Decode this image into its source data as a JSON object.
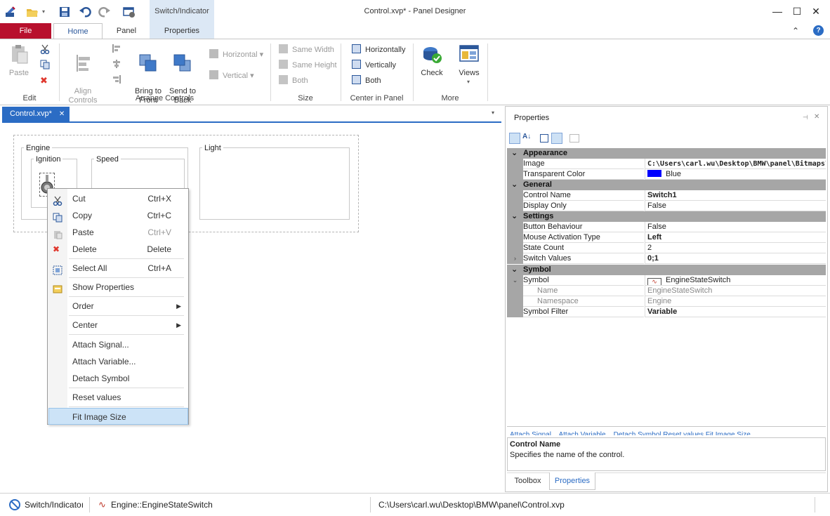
{
  "titlebar": {
    "context_tab_group": "Switch/Indicator",
    "title": "Control.xvp* - Panel Designer",
    "minimize": "—",
    "maximize": "☐",
    "close": "✕"
  },
  "ribbon_tabs": {
    "file": "File",
    "home": "Home",
    "panel": "Panel",
    "properties": "Properties"
  },
  "ribbon": {
    "edit": {
      "paste": "Paste",
      "group": "Edit"
    },
    "arrange": {
      "align": "Align\nControls",
      "bring_front": "Bring to\nFront",
      "send_back": "Send to\nBack",
      "horizontal": "Horizontal",
      "vertical": "Vertical",
      "group": "Arrange Controls"
    },
    "size": {
      "same_width": "Same Width",
      "same_height": "Same Height",
      "both": "Both",
      "group": "Size"
    },
    "center": {
      "horizontally": "Horizontally",
      "vertically": "Vertically",
      "both": "Both",
      "group": "Center in Panel"
    },
    "more": {
      "check": "Check",
      "views": "Views",
      "group": "More"
    }
  },
  "document": {
    "tab": "Control.xvp*",
    "groups": {
      "engine": "Engine",
      "ignition": "Ignition",
      "speed": "Speed",
      "light": "Light"
    }
  },
  "context_menu": {
    "items": [
      {
        "label": "Cut",
        "shortcut": "Ctrl+X"
      },
      {
        "label": "Copy",
        "shortcut": "Ctrl+C"
      },
      {
        "label": "Paste",
        "shortcut": "Ctrl+V"
      },
      {
        "label": "Delete",
        "shortcut": "Delete"
      },
      {
        "label": "Select All",
        "shortcut": "Ctrl+A"
      },
      {
        "label": "Show Properties",
        "shortcut": ""
      },
      {
        "label": "Order",
        "shortcut": ""
      },
      {
        "label": "Center",
        "shortcut": ""
      },
      {
        "label": "Attach Signal...",
        "shortcut": ""
      },
      {
        "label": "Attach Variable...",
        "shortcut": ""
      },
      {
        "label": "Detach Symbol",
        "shortcut": ""
      },
      {
        "label": "Reset values",
        "shortcut": ""
      },
      {
        "label": "Fit Image Size",
        "shortcut": ""
      }
    ]
  },
  "properties": {
    "title": "Properties",
    "categories": {
      "appearance": "Appearance",
      "general": "General",
      "settings": "Settings",
      "symbol": "Symbol"
    },
    "rows": {
      "image": {
        "name": "Image",
        "value": "C:\\Users\\carl.wu\\Desktop\\BMW\\panel\\Bitmaps\\"
      },
      "transparent": {
        "name": "Transparent Color",
        "value": "Blue",
        "color": "#0000ff"
      },
      "control_name": {
        "name": "Control Name",
        "value": "Switch1"
      },
      "display_only": {
        "name": "Display Only",
        "value": "False"
      },
      "button_behaviour": {
        "name": "Button Behaviour",
        "value": "False"
      },
      "mouse_activation": {
        "name": "Mouse Activation Type",
        "value": "Left"
      },
      "state_count": {
        "name": "State Count",
        "value": "2"
      },
      "switch_values": {
        "name": "Switch Values",
        "value": "0;1"
      },
      "symbol": {
        "name": "Symbol",
        "value": "EngineStateSwitch"
      },
      "sym_name": {
        "name": "Name",
        "value": "EngineStateSwitch"
      },
      "sym_namespace": {
        "name": "Namespace",
        "value": "Engine"
      },
      "symbol_filter": {
        "name": "Symbol Filter",
        "value": "Variable"
      }
    },
    "commands": "Attach Signal... Attach Variable... Detach Symbol Reset values Fit Image Size",
    "help_title": "Control Name",
    "help_text": "Specifies the name of the control.",
    "bottom_tabs": {
      "toolbox": "Toolbox",
      "properties": "Properties"
    }
  },
  "statusbar": {
    "item1": "Switch/Indicatoı",
    "item2": "Engine::EngineStateSwitch",
    "item3": "C:\\Users\\carl.wu\\Desktop\\BMW\\panel\\Control.xvp"
  }
}
